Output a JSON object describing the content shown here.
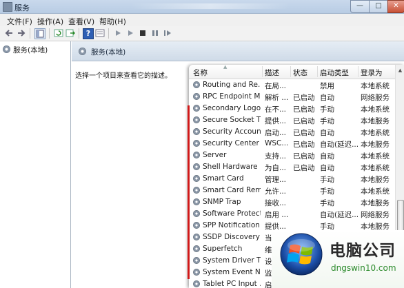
{
  "window": {
    "title": "服务",
    "buttons": {
      "minimize": "—",
      "maximize": "□",
      "close": "✕"
    }
  },
  "menu": [
    "文件(F)",
    "操作(A)",
    "查看(V)",
    "帮助(H)"
  ],
  "toolbar": {
    "icons": [
      "back-icon",
      "forward-icon",
      "show-hide-tree-icon",
      "refresh-icon",
      "export-list-icon",
      "help-icon",
      "properties-icon",
      "start-service-icon",
      "start-alt-icon",
      "stop-service-icon",
      "pause-service-icon",
      "restart-service-icon"
    ]
  },
  "tree": {
    "item": "服务(本地)"
  },
  "panel": {
    "header_title": "服务(本地)",
    "description_prompt": "选择一个项目来查看它的描述。"
  },
  "table": {
    "columns": [
      "名称",
      "描述",
      "状态",
      "启动类型",
      "登录为"
    ],
    "rows": [
      {
        "name": "Routing and Re...",
        "desc": "在局...",
        "status": "",
        "startup": "禁用",
        "logon": "本地系统"
      },
      {
        "name": "RPC Endpoint M...",
        "desc": "解析 ...",
        "status": "已启动",
        "startup": "自动",
        "logon": "网络服务"
      },
      {
        "name": "Secondary Logon",
        "desc": "在不...",
        "status": "已启动",
        "startup": "手动",
        "logon": "本地系统"
      },
      {
        "name": "Secure Socket T...",
        "desc": "提供...",
        "status": "已启动",
        "startup": "手动",
        "logon": "本地服务"
      },
      {
        "name": "Security Account...",
        "desc": "启动...",
        "status": "已启动",
        "startup": "自动",
        "logon": "本地系统"
      },
      {
        "name": "Security Center",
        "desc": "WSC...",
        "status": "已启动",
        "startup": "自动(延迟...",
        "logon": "本地服务"
      },
      {
        "name": "Server",
        "desc": "支持...",
        "status": "已启动",
        "startup": "自动",
        "logon": "本地系统"
      },
      {
        "name": "Shell Hardware ...",
        "desc": "为自...",
        "status": "已启动",
        "startup": "自动",
        "logon": "本地系统"
      },
      {
        "name": "Smart Card",
        "desc": "管理...",
        "status": "",
        "startup": "手动",
        "logon": "本地服务"
      },
      {
        "name": "Smart Card Rem...",
        "desc": "允许...",
        "status": "",
        "startup": "手动",
        "logon": "本地系统"
      },
      {
        "name": "SNMP Trap",
        "desc": "接收...",
        "status": "",
        "startup": "手动",
        "logon": "本地服务"
      },
      {
        "name": "Software Protect...",
        "desc": "启用 ...",
        "status": "",
        "startup": "自动(延迟...",
        "logon": "网络服务"
      },
      {
        "name": "SPP Notification ...",
        "desc": "提供...",
        "status": "",
        "startup": "手动",
        "logon": "本地服务"
      },
      {
        "name": "SSDP Discovery",
        "desc": "当...",
        "status": "",
        "startup": "",
        "logon": ""
      },
      {
        "name": "Superfetch",
        "desc": "维...",
        "status": "",
        "startup": "",
        "logon": ""
      },
      {
        "name": "System Driver T...",
        "desc": "设...",
        "status": "",
        "startup": "",
        "logon": ""
      },
      {
        "name": "System Event N...",
        "desc": "监...",
        "status": "",
        "startup": "",
        "logon": ""
      },
      {
        "name": "Tablet PC Input ...",
        "desc": "启...",
        "status": "",
        "startup": "",
        "logon": ""
      }
    ]
  },
  "watermark": {
    "title": "电脑公司",
    "url": "dngswin10.com"
  },
  "colors": {
    "highlight_line": "#d11919",
    "titlebar": "#c9d9ec",
    "watermark_url": "#2b8a2b"
  }
}
